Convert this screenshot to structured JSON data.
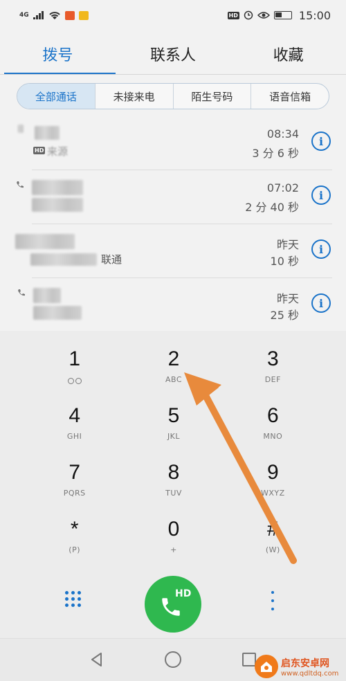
{
  "status_bar": {
    "network": "4G",
    "time": "15:00",
    "hd": "HD"
  },
  "tabs": [
    {
      "label": "拨号",
      "active": true
    },
    {
      "label": "联系人",
      "active": false
    },
    {
      "label": "收藏",
      "active": false
    }
  ],
  "filters": [
    {
      "label": "全部通话",
      "active": true
    },
    {
      "label": "未接来电",
      "active": false
    },
    {
      "label": "陌生号码",
      "active": false
    },
    {
      "label": "语音信箱",
      "active": false
    }
  ],
  "calls": [
    {
      "sub": "来源",
      "time": "08:34",
      "duration": "3 分 6 秒",
      "hd": "HD"
    },
    {
      "sub": "",
      "time": "07:02",
      "duration": "2 分 40 秒"
    },
    {
      "sub": "联通",
      "time": "昨天",
      "duration": "10 秒"
    },
    {
      "sub": "",
      "time": "昨天",
      "duration": "25 秒"
    }
  ],
  "keypad": [
    {
      "digit": "1",
      "letters": ""
    },
    {
      "digit": "2",
      "letters": "ABC"
    },
    {
      "digit": "3",
      "letters": "DEF"
    },
    {
      "digit": "4",
      "letters": "GHI"
    },
    {
      "digit": "5",
      "letters": "JKL"
    },
    {
      "digit": "6",
      "letters": "MNO"
    },
    {
      "digit": "7",
      "letters": "PQRS"
    },
    {
      "digit": "8",
      "letters": "TUV"
    },
    {
      "digit": "9",
      "letters": "WXYZ"
    },
    {
      "digit": "*",
      "letters": "(P)"
    },
    {
      "digit": "0",
      "letters": "+"
    },
    {
      "digit": "#",
      "letters": "(W)"
    }
  ],
  "call_button": {
    "label": "HD"
  },
  "watermark": {
    "title": "启东安卓网",
    "url": "www.qdltdq.com"
  },
  "colors": {
    "accent": "#1a73c9",
    "call_green": "#2fb84f",
    "arrow": "#e88a3c"
  },
  "icons": {
    "info": "i"
  }
}
